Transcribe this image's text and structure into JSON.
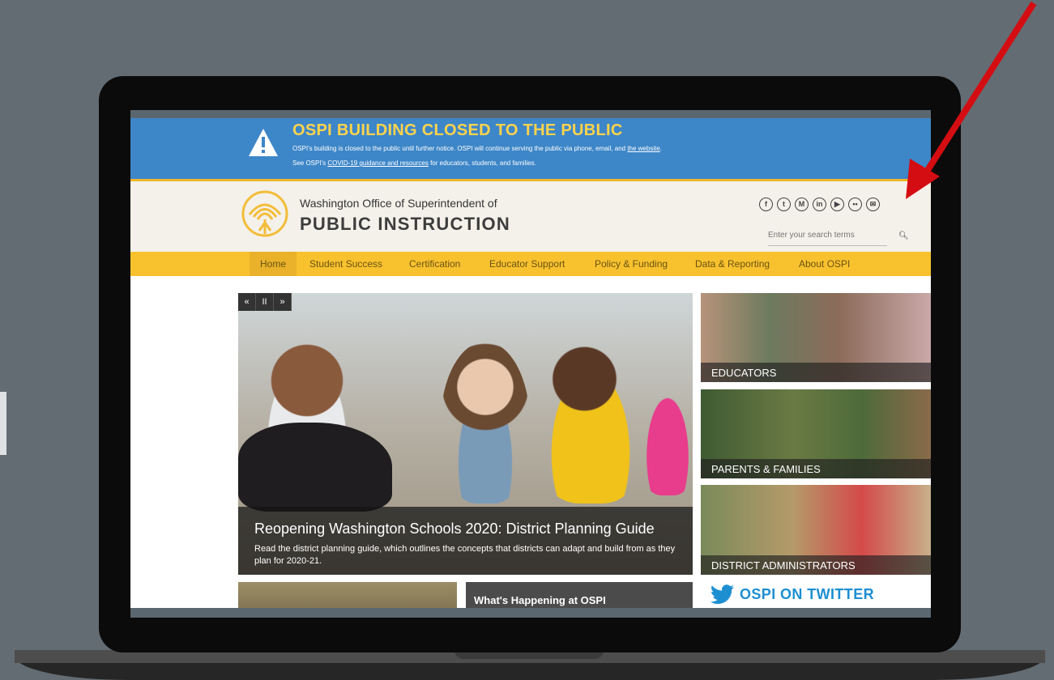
{
  "alert": {
    "title": "OSPI BUILDING CLOSED TO THE PUBLIC",
    "line1_text": "OSPI's building is closed to the public until further notice. OSPI will continue serving the public via phone, email, and ",
    "line1_link": "the website",
    "line1_end": ".",
    "line2_pre": "See OSPI's ",
    "line2_link": "COVID-19 guidance and resources",
    "line2_post": " for educators, students, and families."
  },
  "header": {
    "org_small": "Washington Office of Superintendent of",
    "org_big": "PUBLIC INSTRUCTION",
    "social": [
      {
        "glyph": "f",
        "icon": "facebook-icon"
      },
      {
        "glyph": "t",
        "icon": "twitter-icon"
      },
      {
        "glyph": "M",
        "icon": "medium-icon"
      },
      {
        "glyph": "in",
        "icon": "linkedin-icon"
      },
      {
        "glyph": "▶",
        "icon": "youtube-icon"
      },
      {
        "glyph": "••",
        "icon": "flickr-icon"
      },
      {
        "glyph": "✉",
        "icon": "chat-icon"
      }
    ],
    "search_placeholder": "Enter your search terms",
    "search_icon": "search-icon"
  },
  "nav": {
    "items": [
      "Home",
      "Student Success",
      "Certification",
      "Educator Support",
      "Policy & Funding",
      "Data & Reporting",
      "About OSPI"
    ],
    "active": "Home"
  },
  "hero": {
    "controls": [
      "«",
      "II",
      "»"
    ],
    "title": "Reopening Washington Schools 2020: District Planning Guide",
    "description": "Read the district planning guide, which outlines the concepts that districts can adapt and build from as they plan for 2020-21."
  },
  "tiles": [
    "EDUCATORS",
    "PARENTS & FAMILIES",
    "DISTRICT ADMINISTRATORS"
  ],
  "happening": {
    "title": "What's Happening at OSPI"
  },
  "twitter": {
    "label": "OSPI ON TWITTER"
  },
  "colors": {
    "alert_bg": "#3d86c8",
    "alert_title": "#ffd34d",
    "nav_bg": "#f8c12e",
    "masthead_bg": "#f4f1ea",
    "twitter_blue": "#1d8fd1",
    "annotation_arrow": "#d40d12"
  }
}
